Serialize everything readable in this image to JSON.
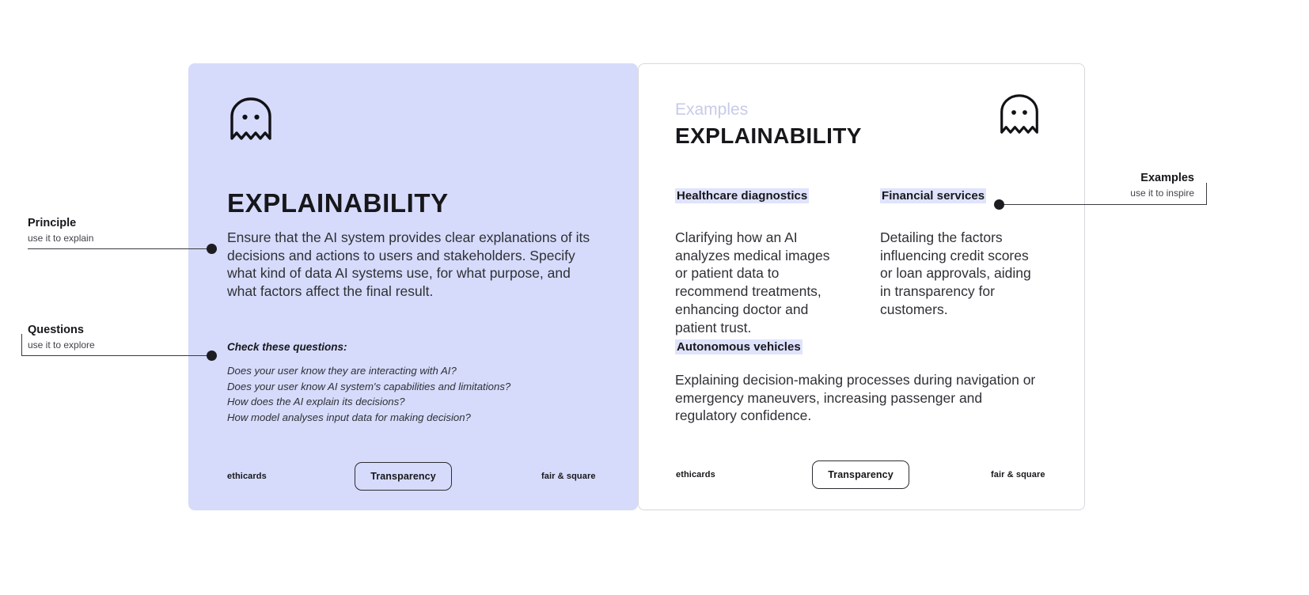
{
  "theme": {
    "card_bg": "#d6dbfb",
    "highlight_bg": "#dfe3fc",
    "kicker_color": "#c7cbe8",
    "text_color": "#2f3035",
    "heading_color": "#17171b",
    "border_color": "#d8d8dd"
  },
  "callouts": {
    "principle": {
      "title": "Principle",
      "subtitle": "use it to explain"
    },
    "questions": {
      "title": "Questions",
      "subtitle": "use it to explore"
    },
    "examples": {
      "title": "Examples",
      "subtitle": "use it to inspire"
    }
  },
  "left_card": {
    "icon": "ghost-icon",
    "title": "EXPLAINABILITY",
    "body": "Ensure that the AI system provides clear explanations of its decisions and actions to users and stakeholders. Specify what kind of data AI systems use, for what purpose, and what factors affect the final result.",
    "questions_heading": "Check these questions:",
    "questions": [
      "Does your user know they are interacting with AI?",
      "Does your user know AI system's capabilities and limitations?",
      "How does the AI explain its decisions?",
      "How model analyses input data for making decision?"
    ],
    "footer": {
      "brand": "ethicards",
      "pill": "Transparency",
      "tagline": "fair & square"
    }
  },
  "right_card": {
    "icon": "ghost-icon",
    "kicker": "Examples",
    "title": "EXPLAINABILITY",
    "examples": [
      {
        "heading": "Healthcare diagnostics",
        "body": "Clarifying how an AI analyzes medical images or patient data to recommend treatments, enhancing doctor and patient trust."
      },
      {
        "heading": "Financial services",
        "body": "Detailing the factors influencing credit scores or loan approvals, aiding in transparency for customers."
      },
      {
        "heading": "Autonomous vehicles",
        "body": "Explaining decision-making processes during navigation or emergency maneuvers, increasing passenger and regulatory confidence."
      }
    ],
    "footer": {
      "brand": "ethicards",
      "pill": "Transparency",
      "tagline": "fair & square"
    }
  }
}
